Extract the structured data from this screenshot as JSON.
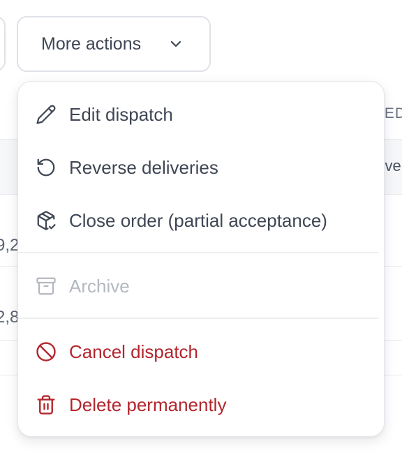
{
  "toolbar": {
    "more_actions_label": "More actions"
  },
  "background": {
    "column_header_fragment": "ED",
    "column_value_fragment": "ver",
    "row1_fragment": "9,2",
    "row2_fragment": "2,8"
  },
  "menu": {
    "items": [
      {
        "label": "Edit dispatch",
        "icon": "pencil-icon",
        "state": "normal"
      },
      {
        "label": "Reverse deliveries",
        "icon": "rotate-ccw-icon",
        "state": "normal"
      },
      {
        "label": "Close order (partial acceptance)",
        "icon": "package-check-icon",
        "state": "normal"
      },
      {
        "label": "Archive",
        "icon": "archive-icon",
        "state": "disabled"
      },
      {
        "label": "Cancel dispatch",
        "icon": "ban-icon",
        "state": "danger"
      },
      {
        "label": "Delete permanently",
        "icon": "trash-icon",
        "state": "danger"
      }
    ]
  },
  "colors": {
    "text": "#3f4654",
    "disabled": "#b4b8bf",
    "danger": "#b3262d",
    "border": "#dfe2e7"
  }
}
